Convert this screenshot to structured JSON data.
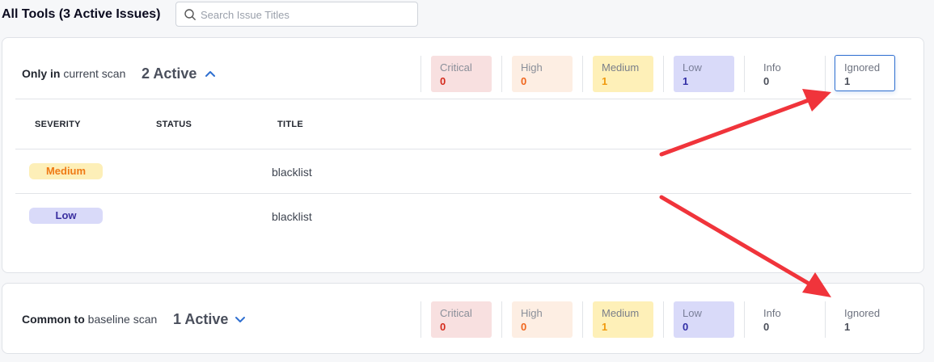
{
  "header": {
    "title": "All Tools (3 Active Issues)",
    "search_placeholder": "Search Issue Titles",
    "search_value": ""
  },
  "sections": [
    {
      "label_bold": "Only in",
      "label_rest": " current scan",
      "active_label": "2 Active",
      "expanded": true,
      "counts": {
        "critical": {
          "label": "Critical",
          "count": "0"
        },
        "high": {
          "label": "High",
          "count": "0"
        },
        "medium": {
          "label": "Medium",
          "count": "1"
        },
        "low": {
          "label": "Low",
          "count": "1"
        },
        "info": {
          "label": "Info",
          "count": "0"
        },
        "ignored": {
          "label": "Ignored",
          "count": "1"
        }
      },
      "columns": [
        "SEVERITY",
        "STATUS",
        "TITLE"
      ],
      "rows": [
        {
          "severity": "Medium",
          "status": "",
          "title": "blacklist"
        },
        {
          "severity": "Low",
          "status": "",
          "title": "blacklist"
        }
      ]
    },
    {
      "label_bold": "Common to",
      "label_rest": " baseline scan",
      "active_label": "1 Active",
      "expanded": false,
      "counts": {
        "critical": {
          "label": "Critical",
          "count": "0"
        },
        "high": {
          "label": "High",
          "count": "0"
        },
        "medium": {
          "label": "Medium",
          "count": "1"
        },
        "low": {
          "label": "Low",
          "count": "0"
        },
        "info": {
          "label": "Info",
          "count": "0"
        },
        "ignored": {
          "label": "Ignored",
          "count": "1"
        }
      }
    }
  ],
  "colors": {
    "accent": "#2f6fd0",
    "annotation_arrow": "#f0343b",
    "critical": "#d42b1d",
    "high": "#f0661d",
    "medium": "#f09a0e",
    "low": "#322fa6"
  },
  "icons": {
    "search": "search-icon",
    "expand_up": "chevron-up-icon",
    "expand_down": "chevron-down-icon",
    "annotation": "red-arrow-annotation"
  }
}
